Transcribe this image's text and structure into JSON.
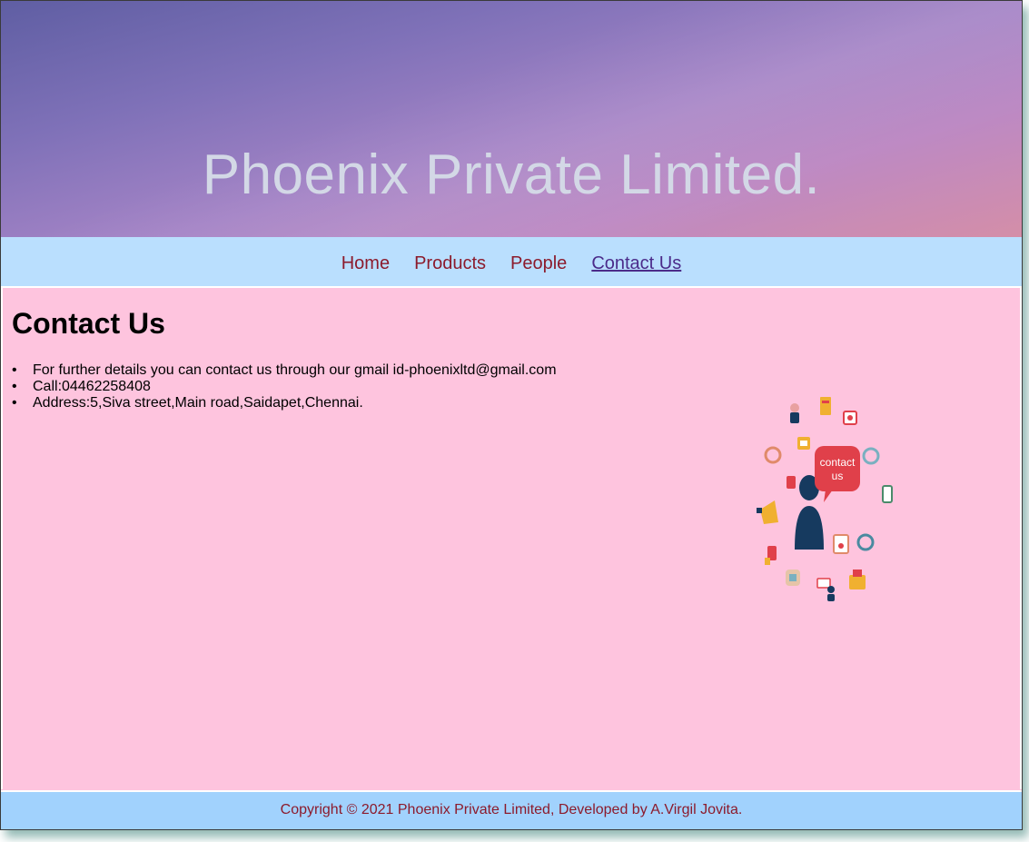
{
  "header": {
    "title": "Phoenix Private Limited."
  },
  "nav": {
    "items": [
      {
        "label": "Home"
      },
      {
        "label": "Products"
      },
      {
        "label": "People"
      },
      {
        "label": "Contact Us"
      }
    ],
    "active": "Contact Us"
  },
  "main": {
    "heading": "Contact Us",
    "items": [
      "For further details you can contact us through our gmail id-phoenixltd@gmail.com",
      "Call:04462258408",
      "Address:5,Siva street,Main road,Saidapet,Chennai."
    ],
    "illustration": {
      "icon": "contact-us-illustration",
      "bubble_text_line1": "contact",
      "bubble_text_line2": "us"
    }
  },
  "footer": {
    "text": "Copyright © 2021 Phoenix Private Limited, Developed by A.Virgil Jovita."
  },
  "colors": {
    "banner_start": "#5f5ea3",
    "banner_end": "#d48ea8",
    "banner_title": "#d3d8e6",
    "nav_bg": "#badffe",
    "nav_link": "#8c1b2c",
    "nav_active": "#4b2b8a",
    "content_bg": "#fec4de",
    "footer_bg": "#a1d2fd",
    "bubble": "#e0404a",
    "figure": "#163a5f"
  }
}
